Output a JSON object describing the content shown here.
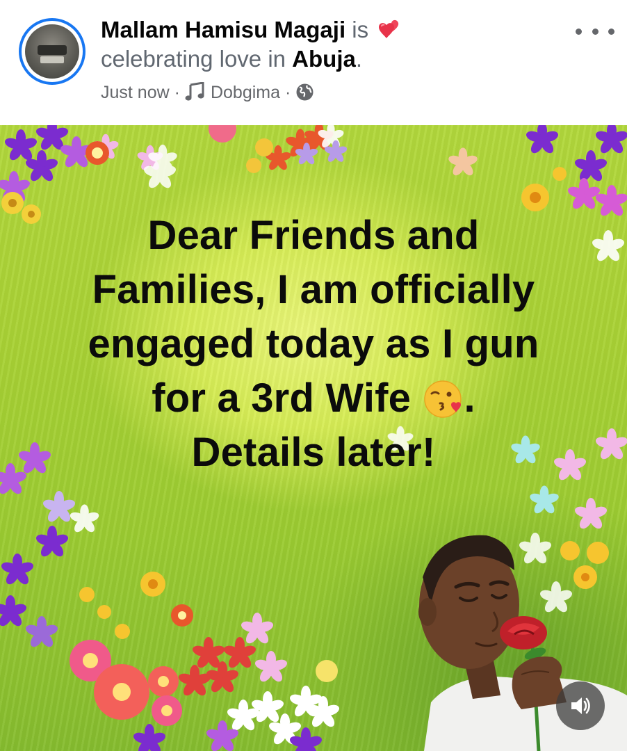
{
  "post": {
    "author": "Mallam Hamisu Magaji",
    "feeling_prefix": "is",
    "feeling_text": "celebrating love in",
    "location": "Abuja",
    "location_suffix": ".",
    "timestamp": "Just now",
    "separator": "·",
    "audio_track": "Dobgima",
    "privacy_icon": "globe-icon",
    "feeling_icon": "two-hearts-icon",
    "more_icon": "more-options-icon"
  },
  "content": {
    "lines": [
      "Dear Friends and",
      "Families, I am officially",
      "engaged today as I gun",
      "for a 3rd Wife",
      "Details later!"
    ],
    "line4_suffix": ".",
    "emoji": "face-blowing-a-kiss"
  },
  "colors": {
    "accent": "#1877f2",
    "text_primary": "#050505",
    "text_secondary": "#65676b",
    "background_green": "#a9d235"
  },
  "controls": {
    "volume_icon": "volume-icon"
  }
}
